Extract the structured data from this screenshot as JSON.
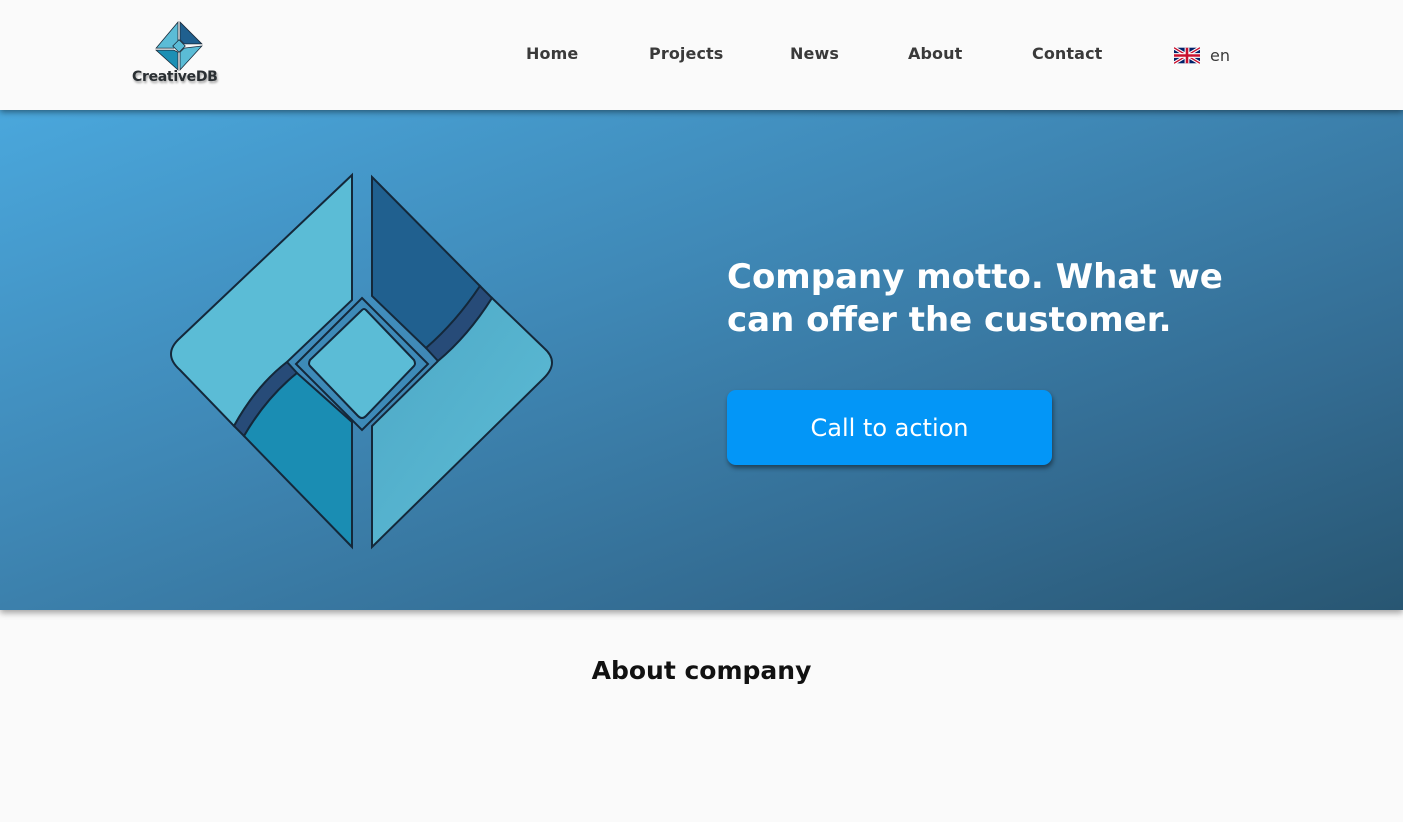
{
  "brand": {
    "name": "CreativeDB",
    "colors": {
      "light": "#5bbcd6",
      "dark": "#20608f",
      "mid": "#1c8fb4",
      "stroke": "#1a2a3a"
    }
  },
  "nav": {
    "items": [
      {
        "label": "Home"
      },
      {
        "label": "Projects"
      },
      {
        "label": "News"
      },
      {
        "label": "About"
      },
      {
        "label": "Contact"
      }
    ],
    "language": {
      "label": "en",
      "flag_icon": "uk-flag-icon"
    }
  },
  "hero": {
    "motto": "Company motto. What we can offer the customer.",
    "cta_label": "Call to action",
    "cta_color": "#0396f7"
  },
  "about": {
    "title": "About company"
  }
}
